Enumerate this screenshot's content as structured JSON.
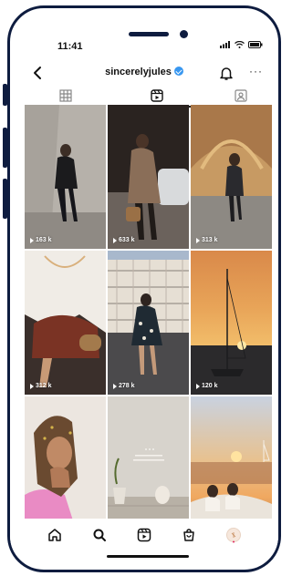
{
  "status": {
    "time": "11:41"
  },
  "header": {
    "username": "sincerelyjules",
    "more": "···"
  },
  "tabs": [
    "grid",
    "reels",
    "tagged"
  ],
  "posts": [
    {
      "views": "163 k"
    },
    {
      "views": "633 k"
    },
    {
      "views": "313 k"
    },
    {
      "views": "312 k"
    },
    {
      "views": "278 k"
    },
    {
      "views": "120 k"
    },
    {
      "views": ""
    },
    {
      "views": ""
    },
    {
      "views": ""
    }
  ],
  "colors": {
    "verified": "#3897f0",
    "frame": "#0e1c3f"
  },
  "nav": [
    "home-icon",
    "search-icon",
    "reels-icon",
    "shop-icon",
    "profile-icon"
  ]
}
